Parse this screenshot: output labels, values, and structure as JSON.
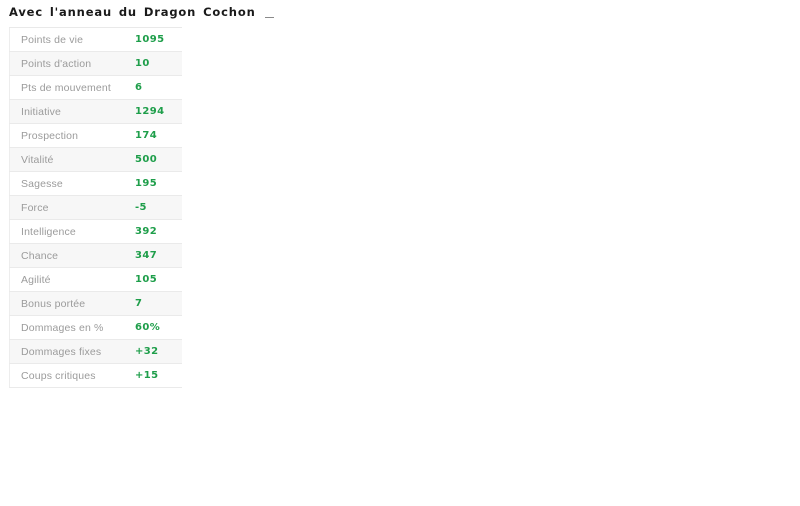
{
  "header": {
    "title": "Avec l'anneau du Dragon Cochon",
    "trailing_mark": "_"
  },
  "colors": {
    "value_green": "#1e9e4a",
    "label_gray": "#9b9b9b",
    "row_separator": "#eaeaea",
    "row_alt_background": "#f7f7f7",
    "page_background": "#ffffff"
  },
  "stats_table": {
    "rows": [
      {
        "label": "Points de vie",
        "value": "1095"
      },
      {
        "label": "Points d'action",
        "value": "10"
      },
      {
        "label": "Pts de mouvement",
        "value": "6"
      },
      {
        "label": "Initiative",
        "value": "1294"
      },
      {
        "label": "Prospection",
        "value": "174"
      },
      {
        "label": "Vitalité",
        "value": "500"
      },
      {
        "label": "Sagesse",
        "value": "195"
      },
      {
        "label": "Force",
        "value": "-5"
      },
      {
        "label": "Intelligence",
        "value": "392"
      },
      {
        "label": "Chance",
        "value": "347"
      },
      {
        "label": "Agilité",
        "value": "105"
      },
      {
        "label": "Bonus portée",
        "value": "7"
      },
      {
        "label": "Dommages en %",
        "value": "60%"
      },
      {
        "label": "Dommages fixes",
        "value": "+32"
      },
      {
        "label": "Coups critiques",
        "value": "+15"
      }
    ]
  }
}
